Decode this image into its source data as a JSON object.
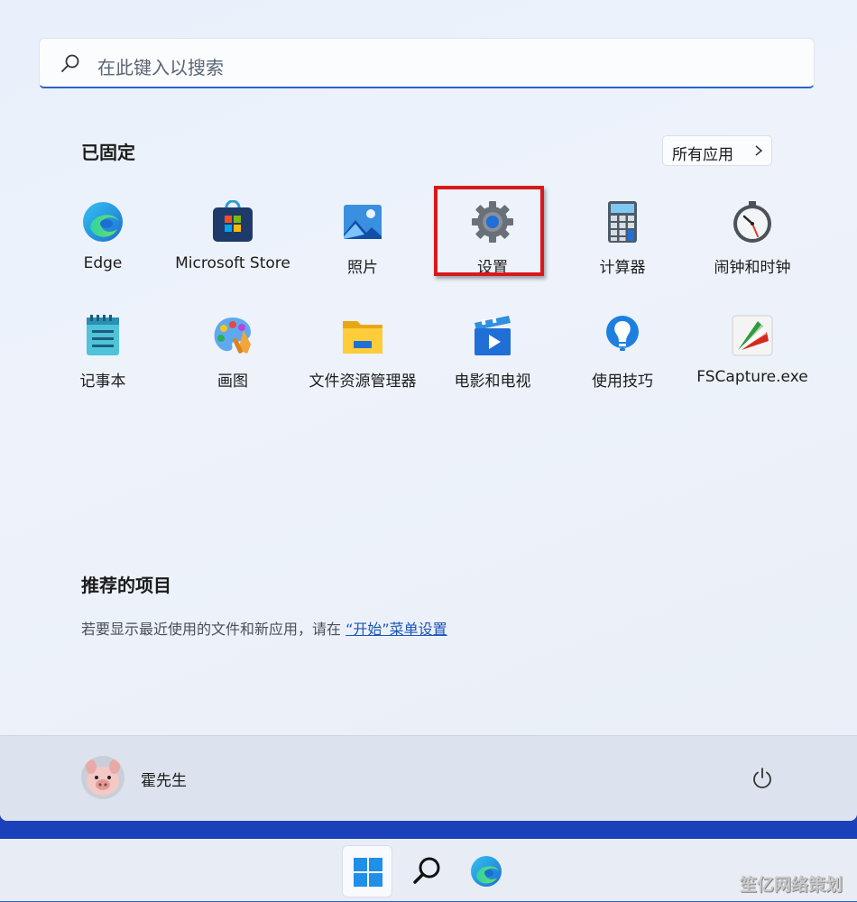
{
  "search": {
    "placeholder": "在此键入以搜索"
  },
  "pinned": {
    "title": "已固定",
    "all_apps_label": "所有应用",
    "apps": [
      {
        "label": "Edge",
        "icon": "edge-icon"
      },
      {
        "label": "Microsoft Store",
        "icon": "microsoft-store-icon"
      },
      {
        "label": "照片",
        "icon": "photos-icon"
      },
      {
        "label": "设置",
        "icon": "settings-gear-icon"
      },
      {
        "label": "计算器",
        "icon": "calculator-icon"
      },
      {
        "label": "闹钟和时钟",
        "icon": "alarm-clock-icon"
      },
      {
        "label": "记事本",
        "icon": "notepad-icon"
      },
      {
        "label": "画图",
        "icon": "paint-palette-icon"
      },
      {
        "label": "文件资源管理器",
        "icon": "file-explorer-folder-icon"
      },
      {
        "label": "电影和电视",
        "icon": "movies-tv-icon"
      },
      {
        "label": "使用技巧",
        "icon": "tips-lightbulb-icon"
      },
      {
        "label": "FSCapture.exe",
        "icon": "fscapture-icon"
      }
    ]
  },
  "recommended": {
    "title": "推荐的项目",
    "text_before": "若要显示最近使用的文件和新应用，请在 ",
    "link": "“开始”菜单设置"
  },
  "user": {
    "name": "霍先生",
    "avatar": "pig-avatar"
  },
  "watermark": "笙亿网络策划",
  "colors": {
    "accent": "#2c63c7",
    "highlight_box": "#d7191c",
    "link": "#1a55b8"
  }
}
